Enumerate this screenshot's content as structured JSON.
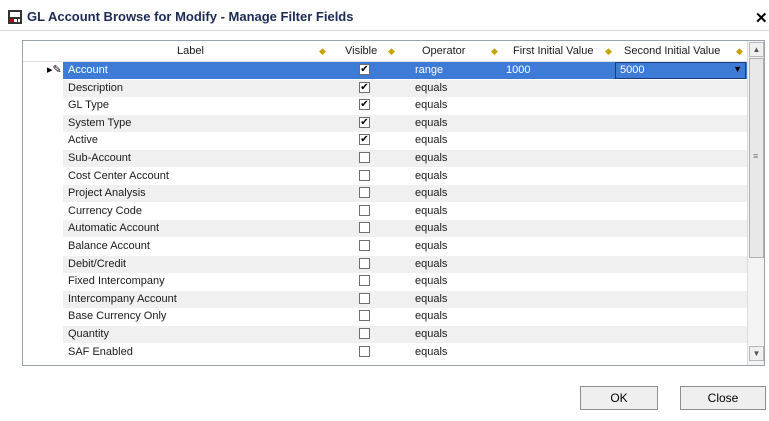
{
  "window": {
    "title": "GL Account Browse for Modify - Manage Filter Fields",
    "close_glyph": "✕"
  },
  "columns": {
    "label": "Label",
    "visible": "Visible",
    "operator": "Operator",
    "first": "First Initial Value",
    "second": "Second Initial Value"
  },
  "rows": [
    {
      "label": "Account",
      "visible": true,
      "operator": "range",
      "first": "1000",
      "second": "5000",
      "selected": true
    },
    {
      "label": "Description",
      "visible": true,
      "operator": "equals"
    },
    {
      "label": "GL Type",
      "visible": true,
      "operator": "equals"
    },
    {
      "label": "System Type",
      "visible": true,
      "operator": "equals"
    },
    {
      "label": "Active",
      "visible": true,
      "operator": "equals"
    },
    {
      "label": "Sub-Account",
      "visible": false,
      "operator": "equals"
    },
    {
      "label": "Cost Center Account",
      "visible": false,
      "operator": "equals"
    },
    {
      "label": "Project Analysis",
      "visible": false,
      "operator": "equals"
    },
    {
      "label": "Currency Code",
      "visible": false,
      "operator": "equals"
    },
    {
      "label": "Automatic Account",
      "visible": false,
      "operator": "equals"
    },
    {
      "label": "Balance Account",
      "visible": false,
      "operator": "equals"
    },
    {
      "label": "Debit/Credit",
      "visible": false,
      "operator": "equals"
    },
    {
      "label": "Fixed Intercompany",
      "visible": false,
      "operator": "equals"
    },
    {
      "label": "Intercompany Account",
      "visible": false,
      "operator": "equals"
    },
    {
      "label": "Base Currency Only",
      "visible": false,
      "operator": "equals"
    },
    {
      "label": "Quantity",
      "visible": false,
      "operator": "equals"
    },
    {
      "label": "SAF Enabled",
      "visible": false,
      "operator": "equals"
    }
  ],
  "buttons": {
    "ok": "OK",
    "close": "Close"
  },
  "colors": {
    "selection": "#3e7bd6",
    "title": "#1c2a55"
  }
}
